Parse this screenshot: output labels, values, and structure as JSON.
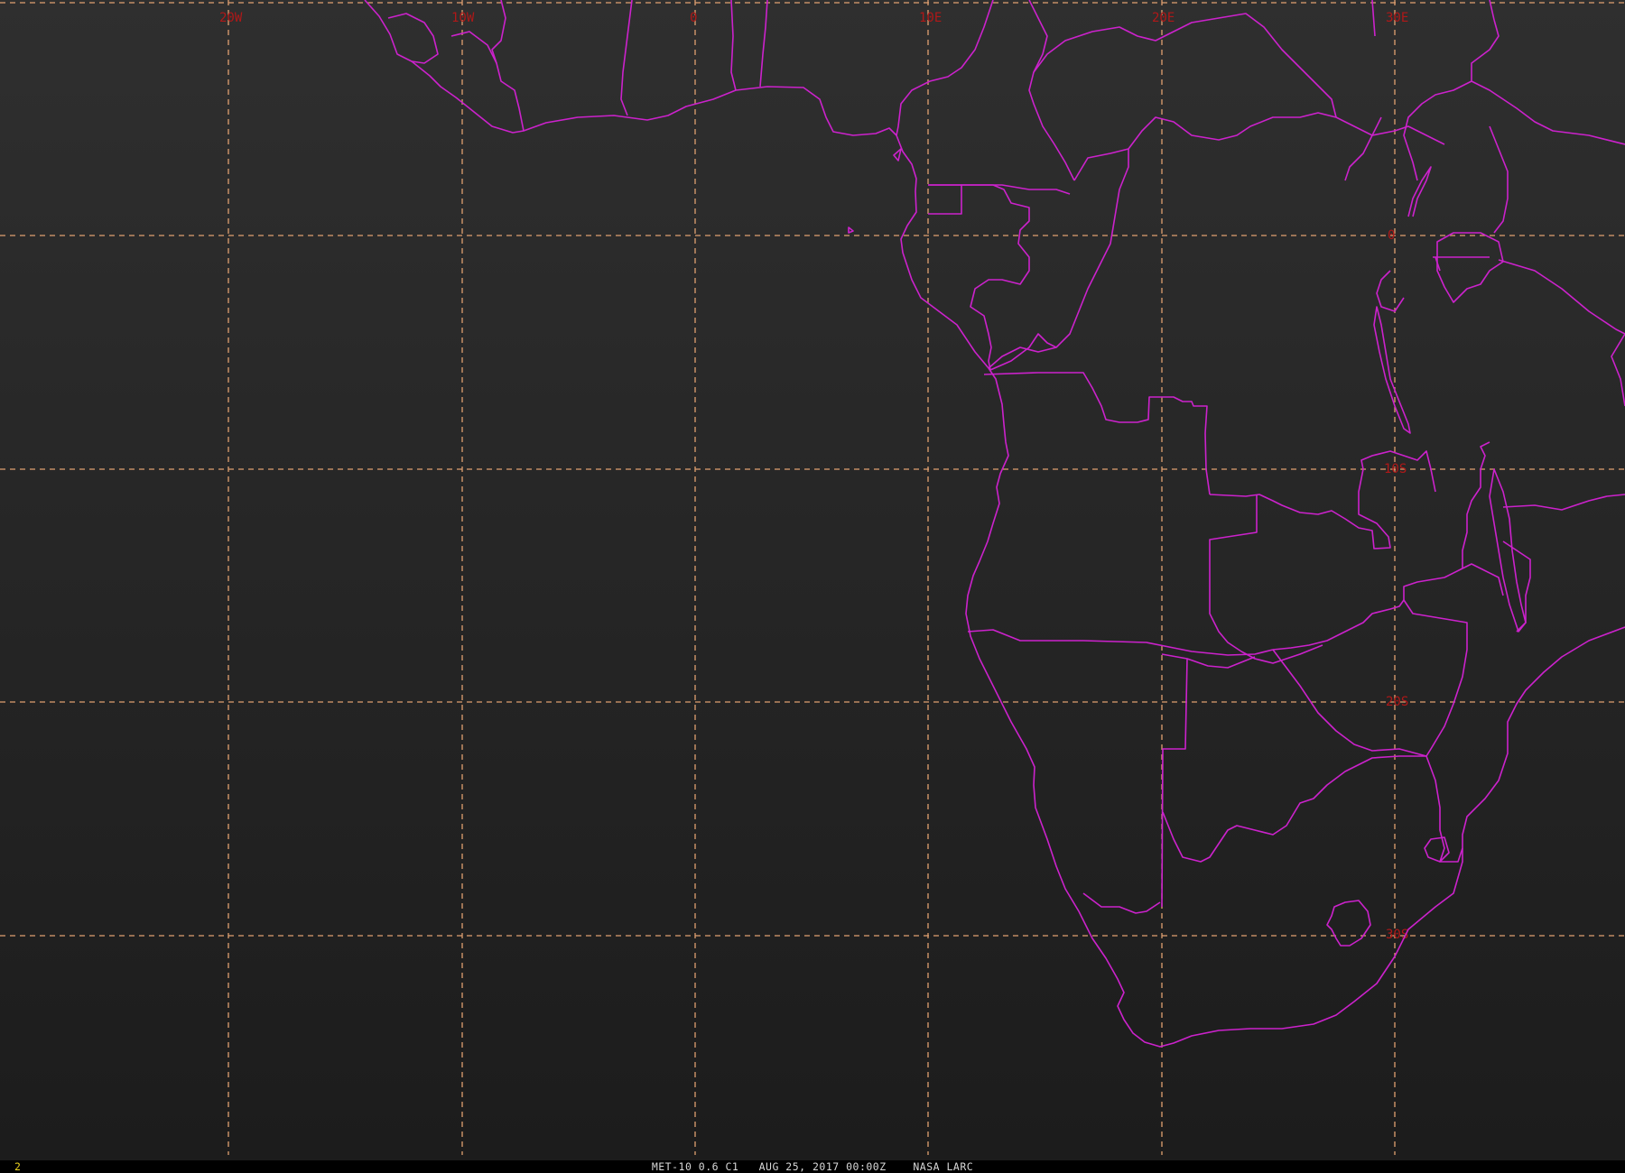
{
  "map": {
    "background_top": "#2f2f2f",
    "background_bottom": "#1c1c1c",
    "border_color": "#cc22cc",
    "grid_color": "#e0a070",
    "label_color": "#b01818",
    "longitude_labels": [
      "20W",
      "10W",
      "0",
      "10E",
      "20E",
      "30E"
    ],
    "latitude_labels": [
      "0",
      "10S",
      "20S",
      "30S"
    ]
  },
  "status_bar": {
    "frame_number": "2",
    "caption": "MET-10 0.6 C1   AUG 25, 2017 00:00Z    NASA LARC"
  }
}
